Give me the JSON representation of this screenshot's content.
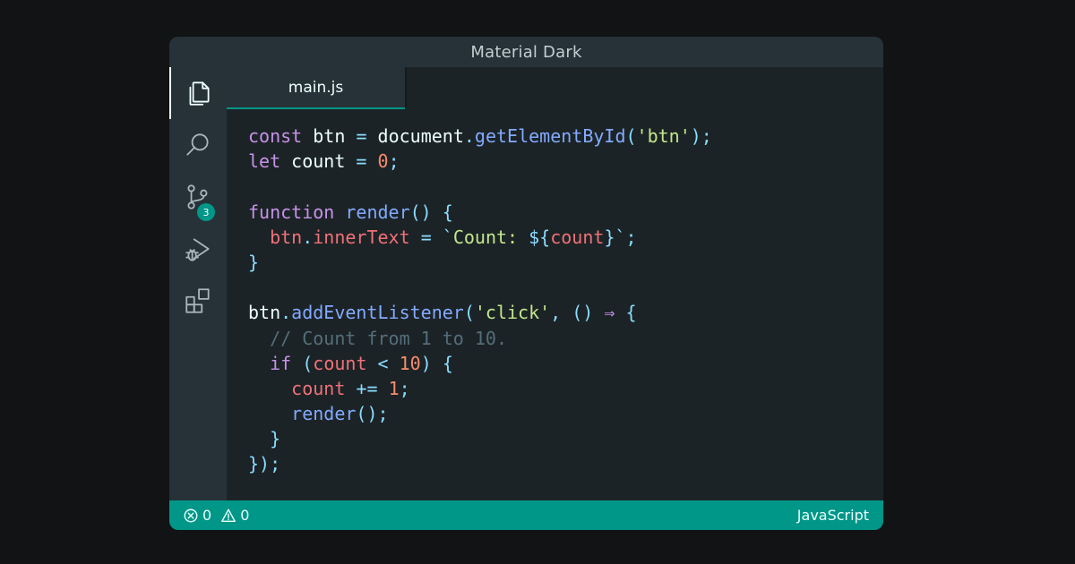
{
  "window": {
    "title": "Material Dark"
  },
  "activity_bar": {
    "items": [
      {
        "name": "explorer",
        "icon": "files-icon",
        "active": true
      },
      {
        "name": "search",
        "icon": "search-icon"
      },
      {
        "name": "source-control",
        "icon": "source-control-icon",
        "badge": "3"
      },
      {
        "name": "run-debug",
        "icon": "run-debug-icon"
      },
      {
        "name": "extensions",
        "icon": "extensions-icon"
      }
    ]
  },
  "editor": {
    "active_tab": "main.js",
    "code_lines": [
      [
        [
          "kw",
          "const"
        ],
        [
          "pl",
          " btn "
        ],
        [
          "pn",
          "="
        ],
        [
          "pl",
          " document"
        ],
        [
          "pn",
          "."
        ],
        [
          "fn",
          "getElementById"
        ],
        [
          "pn",
          "("
        ],
        [
          "str",
          "'btn'"
        ],
        [
          "pn",
          ");"
        ]
      ],
      [
        [
          "kw",
          "let"
        ],
        [
          "pl",
          " count "
        ],
        [
          "pn",
          "="
        ],
        [
          "pl",
          " "
        ],
        [
          "num",
          "0"
        ],
        [
          "pn",
          ";"
        ]
      ],
      [],
      [
        [
          "kw",
          "function"
        ],
        [
          "pl",
          " "
        ],
        [
          "fn",
          "render"
        ],
        [
          "pn",
          "() {"
        ]
      ],
      [
        [
          "pl",
          "  "
        ],
        [
          "var",
          "btn"
        ],
        [
          "pn",
          "."
        ],
        [
          "var",
          "innerText"
        ],
        [
          "pl",
          " "
        ],
        [
          "pn",
          "="
        ],
        [
          "pl",
          " "
        ],
        [
          "pn",
          "`"
        ],
        [
          "str",
          "Count: "
        ],
        [
          "pn",
          "${"
        ],
        [
          "var",
          "count"
        ],
        [
          "pn",
          "}`;"
        ]
      ],
      [
        [
          "pn",
          "}"
        ]
      ],
      [],
      [
        [
          "pl",
          "btn"
        ],
        [
          "pn",
          "."
        ],
        [
          "fn",
          "addEventListener"
        ],
        [
          "pn",
          "("
        ],
        [
          "str",
          "'click'"
        ],
        [
          "pn",
          ", () "
        ],
        [
          "kw",
          "⇒"
        ],
        [
          "pn",
          " {"
        ]
      ],
      [
        [
          "pl",
          "  "
        ],
        [
          "cm",
          "// Count from 1 to 10."
        ]
      ],
      [
        [
          "pl",
          "  "
        ],
        [
          "kw",
          "if"
        ],
        [
          "pl",
          " "
        ],
        [
          "pn",
          "("
        ],
        [
          "var",
          "count"
        ],
        [
          "pl",
          " "
        ],
        [
          "pn",
          "<"
        ],
        [
          "pl",
          " "
        ],
        [
          "num",
          "10"
        ],
        [
          "pn",
          ") {"
        ]
      ],
      [
        [
          "pl",
          "    "
        ],
        [
          "var",
          "count"
        ],
        [
          "pl",
          " "
        ],
        [
          "pn",
          "+="
        ],
        [
          "pl",
          " "
        ],
        [
          "num",
          "1"
        ],
        [
          "pn",
          ";"
        ]
      ],
      [
        [
          "pl",
          "    "
        ],
        [
          "fn",
          "render"
        ],
        [
          "pn",
          "();"
        ]
      ],
      [
        [
          "pl",
          "  "
        ],
        [
          "pn",
          "}"
        ]
      ],
      [
        [
          "pn",
          "});"
        ]
      ]
    ]
  },
  "status_bar": {
    "errors": "0",
    "warnings": "0",
    "language": "JavaScript"
  },
  "colors": {
    "background": "#111315",
    "chrome": "#263238",
    "editor_bg": "#1c2326",
    "accent": "#009688",
    "keyword": "#c792ea",
    "function": "#82aaff",
    "string": "#c3e88d",
    "number": "#f78c6c",
    "variable": "#f07178",
    "punctuation": "#89ddff",
    "comment": "#546e7a"
  }
}
